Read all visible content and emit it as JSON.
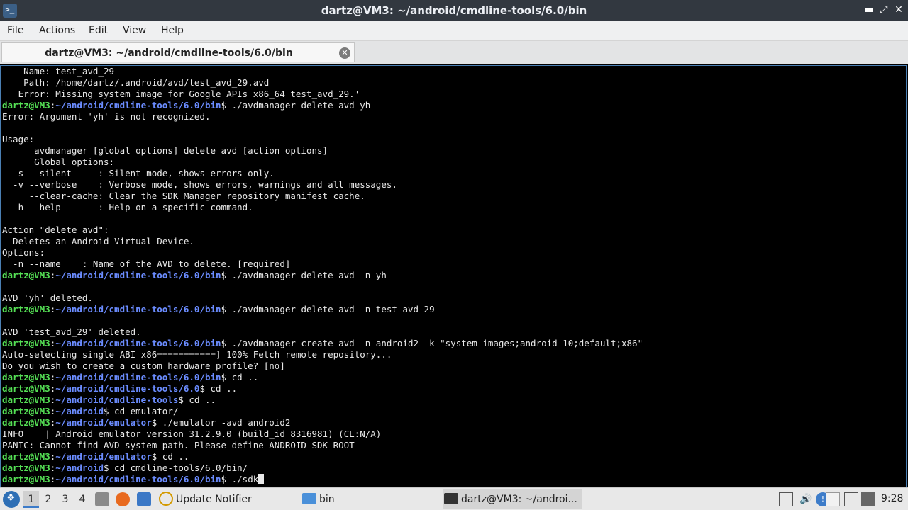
{
  "window": {
    "title": "dartz@VM3: ~/android/cmdline-tools/6.0/bin",
    "controls": {
      "minimize": "▬",
      "maximize": "⤢",
      "close": "✕"
    }
  },
  "menu": [
    "File",
    "Actions",
    "Edit",
    "View",
    "Help"
  ],
  "tab": {
    "label": "dartz@VM3: ~/android/cmdline-tools/6.0/bin",
    "close": "✕"
  },
  "terminal": {
    "lines": [
      {
        "t": "text",
        "v": "    Name: test_avd_29"
      },
      {
        "t": "text",
        "v": "    Path: /home/dartz/.android/avd/test_avd_29.avd"
      },
      {
        "t": "text",
        "v": "   Error: Missing system image for Google APIs x86_64 test_avd_29.'"
      },
      {
        "t": "prompt",
        "u": "dartz@VM3",
        "p": "~/android/cmdline-tools/6.0/bin",
        "c": " ./avdmanager delete avd yh"
      },
      {
        "t": "text",
        "v": "Error: Argument 'yh' is not recognized."
      },
      {
        "t": "text",
        "v": ""
      },
      {
        "t": "text",
        "v": "Usage:"
      },
      {
        "t": "text",
        "v": "      avdmanager [global options] delete avd [action options]"
      },
      {
        "t": "text",
        "v": "      Global options:"
      },
      {
        "t": "text",
        "v": "  -s --silent     : Silent mode, shows errors only."
      },
      {
        "t": "text",
        "v": "  -v --verbose    : Verbose mode, shows errors, warnings and all messages."
      },
      {
        "t": "text",
        "v": "     --clear-cache: Clear the SDK Manager repository manifest cache."
      },
      {
        "t": "text",
        "v": "  -h --help       : Help on a specific command."
      },
      {
        "t": "text",
        "v": ""
      },
      {
        "t": "text",
        "v": "Action \"delete avd\":"
      },
      {
        "t": "text",
        "v": "  Deletes an Android Virtual Device."
      },
      {
        "t": "text",
        "v": "Options:"
      },
      {
        "t": "text",
        "v": "  -n --name    : Name of the AVD to delete. [required]"
      },
      {
        "t": "prompt",
        "u": "dartz@VM3",
        "p": "~/android/cmdline-tools/6.0/bin",
        "c": " ./avdmanager delete avd -n yh"
      },
      {
        "t": "text",
        "v": ""
      },
      {
        "t": "text",
        "v": "AVD 'yh' deleted."
      },
      {
        "t": "prompt",
        "u": "dartz@VM3",
        "p": "~/android/cmdline-tools/6.0/bin",
        "c": " ./avdmanager delete avd -n test_avd_29"
      },
      {
        "t": "text",
        "v": ""
      },
      {
        "t": "text",
        "v": "AVD 'test_avd_29' deleted."
      },
      {
        "t": "prompt",
        "u": "dartz@VM3",
        "p": "~/android/cmdline-tools/6.0/bin",
        "c": " ./avdmanager create avd -n android2 -k \"system-images;android-10;default;x86\""
      },
      {
        "t": "text",
        "v": "Auto-selecting single ABI x86===========] 100% Fetch remote repository..."
      },
      {
        "t": "text",
        "v": "Do you wish to create a custom hardware profile? [no]"
      },
      {
        "t": "prompt",
        "u": "dartz@VM3",
        "p": "~/android/cmdline-tools/6.0/bin",
        "c": " cd .."
      },
      {
        "t": "prompt",
        "u": "dartz@VM3",
        "p": "~/android/cmdline-tools/6.0",
        "c": " cd .."
      },
      {
        "t": "prompt",
        "u": "dartz@VM3",
        "p": "~/android/cmdline-tools",
        "c": " cd .."
      },
      {
        "t": "prompt",
        "u": "dartz@VM3",
        "p": "~/android",
        "c": " cd emulator/"
      },
      {
        "t": "prompt",
        "u": "dartz@VM3",
        "p": "~/android/emulator",
        "c": " ./emulator -avd android2"
      },
      {
        "t": "text",
        "v": "INFO    | Android emulator version 31.2.9.0 (build_id 8316981) (CL:N/A)"
      },
      {
        "t": "text",
        "v": "PANIC: Cannot find AVD system path. Please define ANDROID_SDK_ROOT"
      },
      {
        "t": "prompt",
        "u": "dartz@VM3",
        "p": "~/android/emulator",
        "c": " cd .."
      },
      {
        "t": "prompt",
        "u": "dartz@VM3",
        "p": "~/android",
        "c": " cd cmdline-tools/6.0/bin/"
      },
      {
        "t": "prompt",
        "u": "dartz@VM3",
        "p": "~/android/cmdline-tools/6.0/bin",
        "c": " ./sdk",
        "cursor": true
      }
    ]
  },
  "taskbar": {
    "workspaces": [
      "1",
      "2",
      "3",
      "4"
    ],
    "tasks": [
      {
        "label": "Update Notifier"
      },
      {
        "label": "bin"
      },
      {
        "label": "dartz@VM3: ~/androi..."
      }
    ],
    "clock": "9:28"
  },
  "colors": {
    "prompt_user": "#55e055",
    "prompt_path": "#6b8cff",
    "accent": "#3d7cc9"
  }
}
